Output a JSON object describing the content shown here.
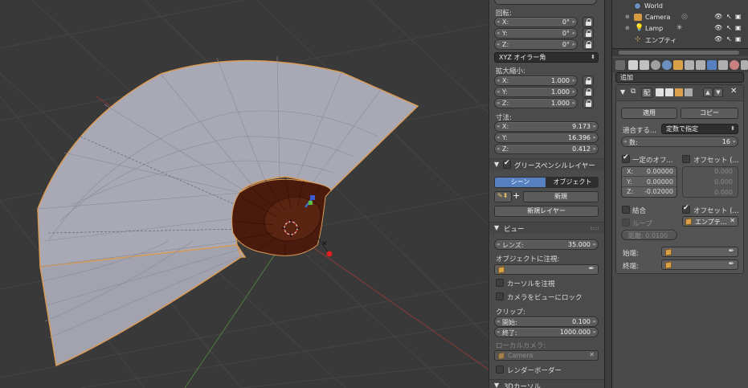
{
  "npanel": {
    "rotation": {
      "label": "回転:",
      "fields": [
        {
          "axis": "X:",
          "value": "0°"
        },
        {
          "axis": "Y:",
          "value": "0°"
        },
        {
          "axis": "Z:",
          "value": "0°"
        }
      ],
      "mode": "XYZ オイラー角"
    },
    "scale": {
      "label": "拡大縮小:",
      "fields": [
        {
          "axis": "X:",
          "value": "1.000"
        },
        {
          "axis": "Y:",
          "value": "1.000"
        },
        {
          "axis": "Z:",
          "value": "1.000"
        }
      ]
    },
    "dimensions": {
      "label": "寸法:",
      "fields": [
        {
          "axis": "X:",
          "value": "9.173"
        },
        {
          "axis": "Y:",
          "value": "16.396"
        },
        {
          "axis": "Z:",
          "value": "0.412"
        }
      ]
    },
    "grease": {
      "title": "グリースペンシルレイヤー",
      "tab_scene": "シーン",
      "tab_object": "オブジェクト",
      "new_label": "新規",
      "new_layer_label": "新規レイヤー"
    },
    "view": {
      "title": "ビュー",
      "lens_label": "レンズ:",
      "lens_value": "35.000",
      "lock_object_label": "オブジェクトに注視:",
      "lock_cursor_label": "カーソルを注視",
      "lock_camera_label": "カメラをビューにロック",
      "clip_label": "クリップ:",
      "clip_start_label": "開始:",
      "clip_start_value": "0.100",
      "clip_end_label": "終了:",
      "clip_end_value": "1000.000",
      "local_camera_label": "ローカルカメラ:",
      "local_camera_value": "Camera",
      "render_border_label": "レンダーボーダー"
    },
    "cursor": {
      "title": "3Dカーソル"
    }
  },
  "outliner": {
    "items": [
      {
        "label": "World"
      },
      {
        "label": "Camera"
      },
      {
        "label": "Lamp"
      },
      {
        "label": "エンプティ"
      }
    ]
  },
  "properties": {
    "add_modifier_label": "追加",
    "modifier": {
      "apply_label": "適用",
      "copy_label": "コピー",
      "fit_label": "適合する...",
      "fit_value": "定数で指定",
      "count_label": "数:",
      "count_value": "16",
      "constant_offset_label": "一定のオフ...",
      "relative_offset_label": "オフセット (...",
      "const_fields": [
        {
          "axis": "X:",
          "value": "0.00000"
        },
        {
          "axis": "Y:",
          "value": "0.00000"
        },
        {
          "axis": "Z:",
          "value": "-0.02000"
        }
      ],
      "rel_fields": [
        {
          "value": "0.000"
        },
        {
          "value": "0.000"
        },
        {
          "value": "0.000"
        }
      ],
      "merge_label": "結合",
      "loop_label": "ループ",
      "distance_label": "距離: 0.0100",
      "object_offset_label": "オフセット (...",
      "object_offset_value": "エンプテ...",
      "start_cap_label": "始端:",
      "end_cap_label": "終端:"
    }
  },
  "colors": {
    "viewport_bg": "#393939",
    "mesh_face": "#a9a9b6",
    "selected_edge": "#d99a55",
    "dark_mesh": "#4a1a0c",
    "x_axis": "#c33a3a",
    "y_axis": "#58a042",
    "tab_active": "#5680c2"
  }
}
